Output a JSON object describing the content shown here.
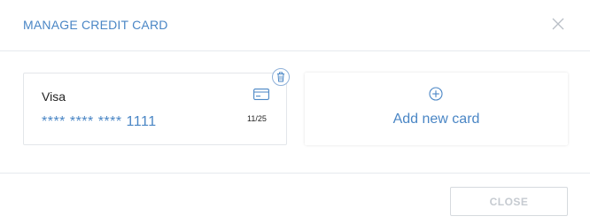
{
  "dialog": {
    "title": "MANAGE CREDIT CARD"
  },
  "card": {
    "name": "Visa",
    "number": "**** **** **** 1111",
    "expiry": "11/25"
  },
  "add_card": {
    "label": "Add new card"
  },
  "footer": {
    "close_label": "CLOSE"
  },
  "colors": {
    "accent": "#4a86c5",
    "border": "#e3e6ea",
    "disabled_text": "#c6cbd1"
  },
  "icons": {
    "close": "close-icon",
    "card": "credit-card-icon",
    "delete": "trash-icon",
    "add": "plus-circle-icon"
  }
}
